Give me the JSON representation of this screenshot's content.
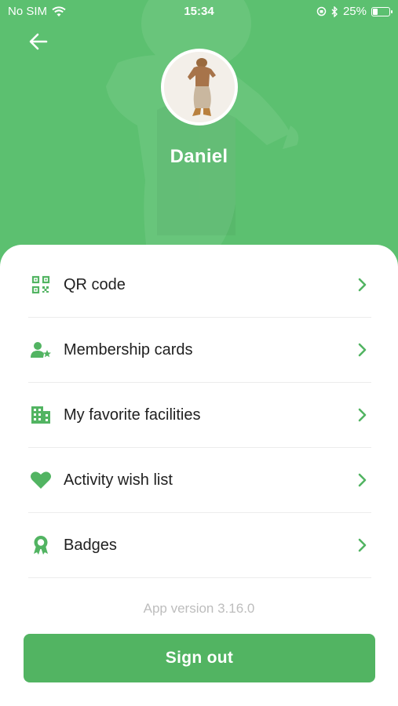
{
  "status_bar": {
    "carrier": "No SIM",
    "time": "15:34",
    "battery": "25%",
    "battery_level": 0.25
  },
  "header": {
    "back_icon": "arrow-left-icon",
    "name": "Daniel"
  },
  "menu": {
    "items": [
      {
        "label": "QR code",
        "icon": "qr-code-icon"
      },
      {
        "label": "Membership cards",
        "icon": "user-star-icon"
      },
      {
        "label": "My favorite facilities",
        "icon": "building-icon"
      },
      {
        "label": "Activity wish list",
        "icon": "heart-icon"
      },
      {
        "label": "Badges",
        "icon": "badge-icon"
      }
    ]
  },
  "app_version": "App version 3.16.0",
  "sign_out_label": "Sign out",
  "colors": {
    "brand_green": "#52b462",
    "hero_green": "#5cc070",
    "muted_text": "#bdbdbd"
  }
}
